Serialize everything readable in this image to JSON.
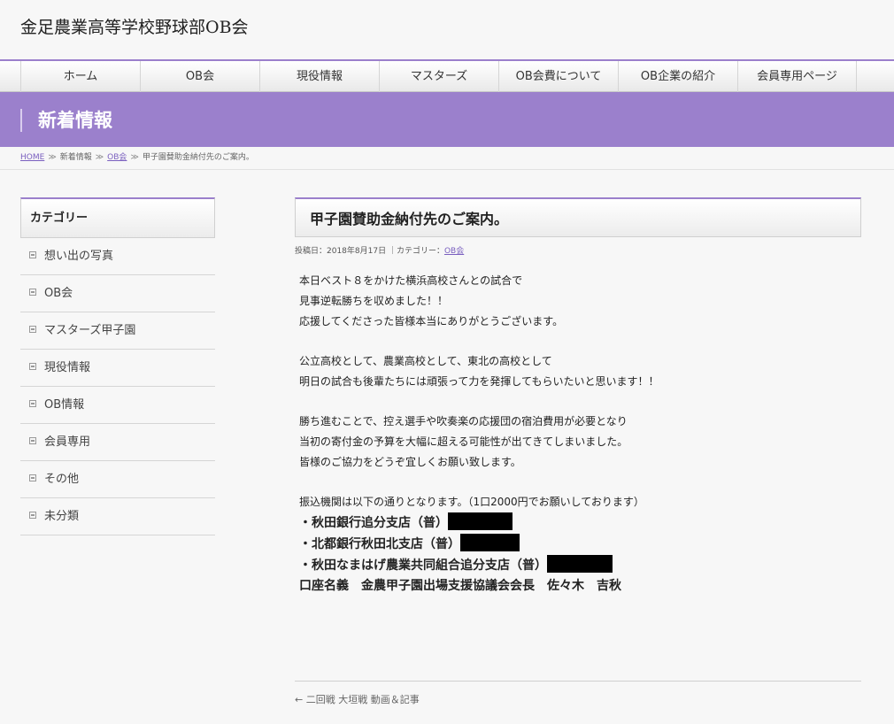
{
  "site": {
    "title": "金足農業高等学校野球部OB会"
  },
  "nav": {
    "items": [
      "ホーム",
      "OB会",
      "現役情報",
      "マスターズ",
      "OB会費について",
      "OB企業の紹介",
      "会員専用ページ"
    ]
  },
  "banner": {
    "title": "新着情報"
  },
  "breadcrumb": {
    "home": "HOME",
    "sep": "≫",
    "news": "新着情報",
    "ob": "OB会",
    "current": "甲子園賛助金納付先のご案内。"
  },
  "sidebar": {
    "title": "カテゴリー",
    "items": [
      "想い出の写真",
      "OB会",
      "マスターズ甲子園",
      "現役情報",
      "OB情報",
      "会員専用",
      "その他",
      "未分類"
    ]
  },
  "entry": {
    "title": "甲子園賛助金納付先のご案内。",
    "meta_prefix": "投稿日：2018年8月17日 ｜カテゴリー：",
    "meta_category": "OB会",
    "paragraphs": [
      [
        "本日ベスト８をかけた横浜高校さんとの試合で",
        "見事逆転勝ちを収めました！！",
        "応援してくださった皆様本当にありがとうございます。"
      ],
      [
        "公立高校として、農業高校として、東北の高校として",
        "明日の試合も後輩たちには頑張って力を発揮してもらいたいと思います！！"
      ],
      [
        "勝ち進むことで、控え選手や吹奏楽の応援団の宿泊費用が必要となり",
        "当初の寄付金の予算を大幅に超える可能性が出てきてしまいました。",
        "皆様のご協力をどうぞ宜しくお願い致します。"
      ]
    ],
    "transfer_intro": "振込機関は以下の通りとなります。（1口2000円でお願いしております）",
    "banks": [
      "・秋田銀行追分支店（普）",
      "・北都銀行秋田北支店（普）",
      "・秋田なまはげ農業共同組合追分支店（普）"
    ],
    "account_name": "口座名義　金農甲子園出場支援協議会会長　佐々木　吉秋"
  },
  "post_nav": {
    "prev": "← 二回戦 大垣戦 動画＆記事"
  },
  "colors": {
    "accent": "#9b80cc",
    "link": "#7a5fbf"
  }
}
